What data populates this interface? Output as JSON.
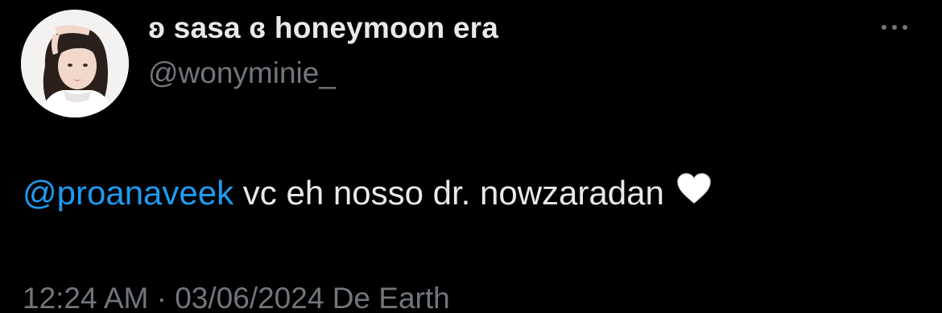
{
  "author": {
    "display_name": "ʚ sasa ɞ honeymoon era",
    "handle": "@wonyminie_",
    "avatar_icon": "profile-photo"
  },
  "menu": {
    "more_icon": "more-horizontal-icon"
  },
  "tweet": {
    "mention": "@proanaveek",
    "body": " vc eh nosso dr. nowzaradan ",
    "emoji": "white-heart-icon"
  },
  "meta": {
    "time": "12:24 AM",
    "separator": " · ",
    "date": "03/06/2024",
    "source": " De Earth"
  },
  "colors": {
    "background": "#000000",
    "text_primary": "#e7e9ea",
    "text_secondary": "#71767b",
    "link": "#1d9bf0"
  }
}
